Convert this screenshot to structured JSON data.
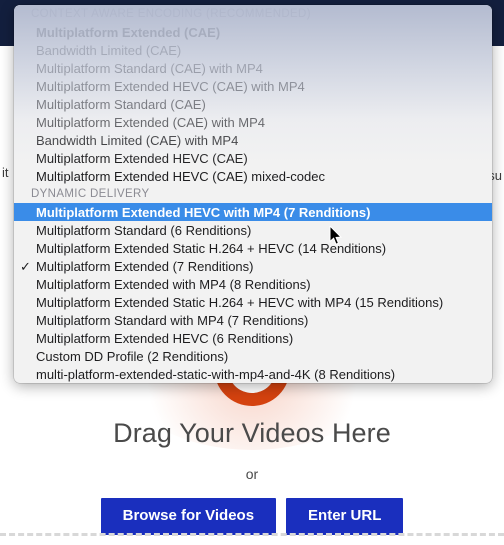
{
  "background": {
    "occluded_left_text": "it",
    "occluded_right_text": "su"
  },
  "dropdown": {
    "groups": [
      {
        "header": "CONTEXT AWARE ENCODING (RECOMMENDED)",
        "items": [
          {
            "label": "Multiplatform Extended (CAE)",
            "bold": true,
            "checked": false,
            "highlighted": false
          },
          {
            "label": "Bandwidth Limited (CAE)",
            "bold": false,
            "checked": false,
            "highlighted": false
          },
          {
            "label": "Multiplatform Standard (CAE) with MP4",
            "bold": false,
            "checked": false,
            "highlighted": false
          },
          {
            "label": "Multiplatform Extended HEVC (CAE) with MP4",
            "bold": false,
            "checked": false,
            "highlighted": false
          },
          {
            "label": "Multiplatform Standard (CAE)",
            "bold": false,
            "checked": false,
            "highlighted": false
          },
          {
            "label": "Multiplatform Extended (CAE) with MP4",
            "bold": false,
            "checked": false,
            "highlighted": false
          },
          {
            "label": "Bandwidth Limited (CAE) with MP4",
            "bold": false,
            "checked": false,
            "highlighted": false
          },
          {
            "label": "Multiplatform Extended HEVC (CAE)",
            "bold": false,
            "checked": false,
            "highlighted": false
          },
          {
            "label": "Multiplatform Extended HEVC (CAE) mixed-codec",
            "bold": false,
            "checked": false,
            "highlighted": false
          }
        ]
      },
      {
        "header": "DYNAMIC DELIVERY",
        "items": [
          {
            "label": "Multiplatform Extended HEVC with MP4 (7 Renditions)",
            "bold": true,
            "checked": false,
            "highlighted": true
          },
          {
            "label": "Multiplatform Standard (6 Renditions)",
            "bold": false,
            "checked": false,
            "highlighted": false
          },
          {
            "label": "Multiplatform Extended Static H.264 + HEVC (14 Renditions)",
            "bold": false,
            "checked": false,
            "highlighted": false
          },
          {
            "label": "Multiplatform Extended (7 Renditions)",
            "bold": false,
            "checked": true,
            "highlighted": false
          },
          {
            "label": "Multiplatform Extended with MP4 (8 Renditions)",
            "bold": false,
            "checked": false,
            "highlighted": false
          },
          {
            "label": "Multiplatform Extended Static H.264 + HEVC with MP4 (15 Renditions)",
            "bold": false,
            "checked": false,
            "highlighted": false
          },
          {
            "label": "Multiplatform Standard with MP4 (7 Renditions)",
            "bold": false,
            "checked": false,
            "highlighted": false
          },
          {
            "label": "Multiplatform Extended HEVC (6 Renditions)",
            "bold": false,
            "checked": false,
            "highlighted": false
          },
          {
            "label": "Custom DD Profile (2 Renditions)",
            "bold": false,
            "checked": false,
            "highlighted": false
          },
          {
            "label": "multi-platform-extended-static-with-mp4-and-4K (8 Renditions)",
            "bold": false,
            "checked": false,
            "highlighted": false
          }
        ]
      }
    ],
    "check_glyph": "✓",
    "highlight_color": "#3a8ce8"
  },
  "dropzone": {
    "title": "Drag Your Videos Here",
    "or_label": "or",
    "browse_button_label": "Browse for Videos",
    "url_button_label": "Enter URL",
    "button_color": "#1a2fbe"
  }
}
